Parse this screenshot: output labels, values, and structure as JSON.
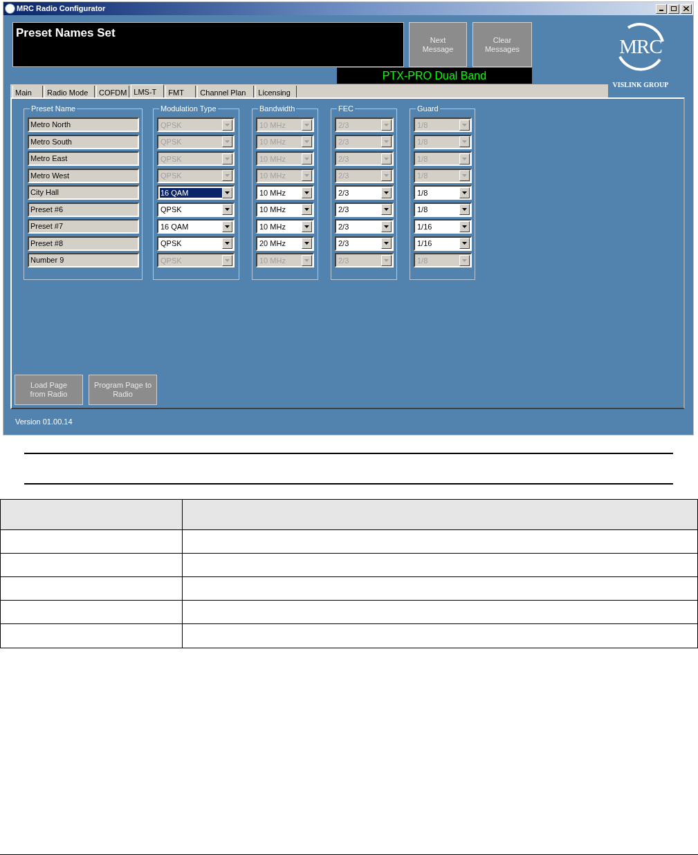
{
  "window": {
    "title": "MRC Radio Configurator"
  },
  "message": {
    "text": "Preset Names Set"
  },
  "message_buttons": [
    "Next Message",
    "Clear Messages"
  ],
  "device": "PTX-PRO Dual Band",
  "logo": {
    "mark": "MRC",
    "tagline": "VISLINK GROUP"
  },
  "tabs": [
    {
      "label": "Main",
      "selected": false
    },
    {
      "label": "Radio Mode",
      "selected": false
    },
    {
      "label": "COFDM",
      "selected": false
    },
    {
      "label": "LMS-T",
      "selected": true
    },
    {
      "label": "FMT",
      "selected": false
    },
    {
      "label": "Channel Plan",
      "selected": false
    },
    {
      "label": "Licensing",
      "selected": false
    }
  ],
  "columns": [
    "Preset Name",
    "Modulation Type",
    "Bandwidth",
    "FEC",
    "Guard"
  ],
  "presets": [
    {
      "name": "Metro North",
      "modulation": "QPSK",
      "bandwidth": "10 MHz",
      "fec": "2/3",
      "guard": "1/8",
      "disabled": true,
      "focused": false
    },
    {
      "name": "Metro South",
      "modulation": "QPSK",
      "bandwidth": "10 MHz",
      "fec": "2/3",
      "guard": "1/8",
      "disabled": true,
      "focused": false
    },
    {
      "name": "Metro East",
      "modulation": "QPSK",
      "bandwidth": "10 MHz",
      "fec": "2/3",
      "guard": "1/8",
      "disabled": true,
      "focused": false
    },
    {
      "name": "Metro West",
      "modulation": "QPSK",
      "bandwidth": "10 MHz",
      "fec": "2/3",
      "guard": "1/8",
      "disabled": true,
      "focused": false
    },
    {
      "name": "City Hall",
      "modulation": "16 QAM",
      "bandwidth": "10 MHz",
      "fec": "2/3",
      "guard": "1/8",
      "disabled": false,
      "focused": true
    },
    {
      "name": "Preset #6",
      "modulation": "QPSK",
      "bandwidth": "10 MHz",
      "fec": "2/3",
      "guard": "1/8",
      "disabled": false,
      "focused": false
    },
    {
      "name": "Preset #7",
      "modulation": "16 QAM",
      "bandwidth": "10 MHz",
      "fec": "2/3",
      "guard": "1/16",
      "disabled": false,
      "focused": false
    },
    {
      "name": "Preset #8",
      "modulation": "QPSK",
      "bandwidth": "20 MHz",
      "fec": "2/3",
      "guard": "1/16",
      "disabled": false,
      "focused": false
    },
    {
      "name": "Number 9",
      "modulation": "QPSK",
      "bandwidth": "10 MHz",
      "fec": "2/3",
      "guard": "1/8",
      "disabled": true,
      "focused": false
    }
  ],
  "page_buttons": [
    "Load Page from Radio",
    "Program Page to Radio"
  ],
  "version": "Version 01.00.14"
}
